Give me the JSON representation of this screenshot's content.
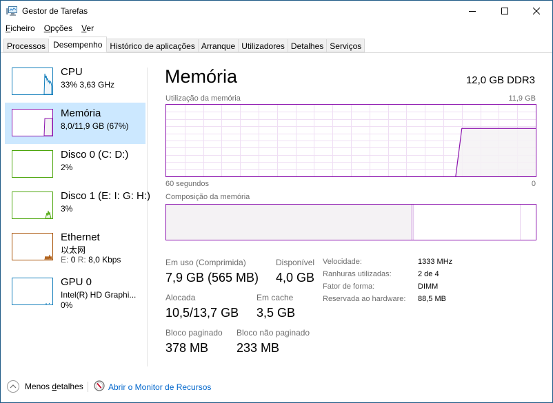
{
  "window": {
    "title": "Gestor de Tarefas",
    "controls": [
      "minimize",
      "maximize",
      "close"
    ]
  },
  "menu": [
    {
      "label": "Ficheiro",
      "accel": "F",
      "rest": "icheiro"
    },
    {
      "label": "Opções",
      "accel": "O",
      "rest": "pções"
    },
    {
      "label": "Ver",
      "accel": "V",
      "rest": "er"
    }
  ],
  "tabs": [
    {
      "label": "Processos",
      "active": false
    },
    {
      "label": "Desempenho",
      "active": true
    },
    {
      "label": "Histórico de aplicações",
      "active": false
    },
    {
      "label": "Arranque",
      "active": false
    },
    {
      "label": "Utilizadores",
      "active": false
    },
    {
      "label": "Detalhes",
      "active": false
    },
    {
      "label": "Serviços",
      "active": false
    }
  ],
  "sidebar": {
    "items": [
      {
        "name": "cpu",
        "title": "CPU",
        "line1": "33% 3,63 GHz",
        "color": "#117dbb",
        "fill": "#f1f6fa",
        "selected": false
      },
      {
        "name": "memory",
        "title": "Memória",
        "line1": "8,0/11,9 GB (67%)",
        "color": "#8b12ae",
        "fill": "#f4f2f4",
        "selected": true
      },
      {
        "name": "disk-0",
        "title": "Disco 0 (C: D:)",
        "line1": "2%",
        "color": "#4da60c",
        "fill": "#eff7ea",
        "selected": false
      },
      {
        "name": "disk-1",
        "title": "Disco 1 (E: I: G: H:)",
        "line1": "3%",
        "color": "#4da60c",
        "fill": "#eff7ea",
        "selected": false
      },
      {
        "name": "ethernet",
        "title": "Ethernet",
        "line1": "以太网",
        "line2_send_label": "E:",
        "line2_send_value": "0",
        "line2_recv_label": "R:",
        "line2_recv_value": "8,0 Kbps",
        "color": "#a74f01",
        "fill": "#fcf3eb",
        "selected": false
      },
      {
        "name": "gpu-0",
        "title": "GPU 0",
        "line1": "Intel(R) HD Graphi...",
        "line2": "0%",
        "color": "#117dbb",
        "fill": "#f1f6fa",
        "selected": false
      }
    ]
  },
  "main": {
    "title": "Memória",
    "spec": "12,0 GB DDR3",
    "usage_graph": {
      "label": "Utilização da memória",
      "max_label": "11,9 GB",
      "x_left_label": "60 segundos",
      "x_right_label": "0",
      "color": "#8b12ae",
      "grid_color": "#efdef4",
      "fill": "#f4f2f4",
      "series_percent": [
        0,
        0,
        0,
        0,
        0,
        0,
        0,
        0,
        0,
        0,
        0,
        0,
        0,
        0,
        0,
        0,
        0,
        0,
        0,
        0,
        0,
        0,
        0,
        0,
        0,
        0,
        0,
        0,
        0,
        0,
        0,
        0,
        0,
        0,
        0,
        0,
        0,
        0,
        0,
        0,
        0,
        0,
        0,
        0,
        0,
        0,
        0,
        0,
        67,
        67,
        67,
        67,
        67,
        67,
        67,
        67,
        67,
        67,
        67,
        67,
        67
      ]
    },
    "composition": {
      "label": "Composição da memória",
      "segments": [
        {
          "name": "in-use",
          "fraction": 0.664,
          "fill": "#f4f2f4"
        },
        {
          "name": "modified",
          "fraction": 0.006,
          "fill": "#efdef4"
        },
        {
          "name": "standby",
          "fraction": 0.288,
          "fill": "#ffffff"
        },
        {
          "name": "free",
          "fraction": 0.042,
          "fill": "#ffffff"
        }
      ]
    },
    "stats": {
      "in_use_label": "Em uso (Comprimida)",
      "in_use_value": "7,9 GB (565 MB)",
      "available_label": "Disponível",
      "available_value": "4,0 GB",
      "committed_label": "Alocada",
      "committed_value": "10,5/13,7 GB",
      "cached_label": "Em cache",
      "cached_value": "3,5 GB",
      "paged_label": "Bloco paginado",
      "paged_value": "378 MB",
      "nonpaged_label": "Bloco não paginado",
      "nonpaged_value": "233 MB"
    },
    "details": [
      {
        "label": "Velocidade:",
        "value": "1333 MHz"
      },
      {
        "label": "Ranhuras utilizadas:",
        "value": "2 de 4"
      },
      {
        "label": "Fator de forma:",
        "value": "DIMM"
      },
      {
        "label": "Reservada ao hardware:",
        "value": "88,5 MB"
      }
    ]
  },
  "footer": {
    "less_details_label": "Menos detalhes",
    "less_details_accel_prefix": "Menos ",
    "less_details_accel": "d",
    "less_details_rest": "etalhes",
    "resource_monitor_label": "Abrir o Monitor de Recursos"
  }
}
